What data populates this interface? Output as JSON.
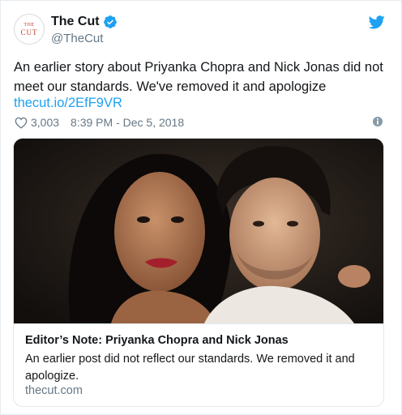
{
  "account": {
    "display_name": "The Cut",
    "handle": "@TheCut",
    "avatar_line1": "THE",
    "avatar_line2": "CUT",
    "verified": true,
    "verified_icon": "verified-badge-icon"
  },
  "tweet": {
    "text": "An earlier story about Priyanka Chopra and Nick Jonas did not meet our standards. We've removed it and apologize",
    "link": "thecut.io/2EfF9VR",
    "likes": "3,003",
    "timestamp": "8:39 PM - Dec 5, 2018"
  },
  "card": {
    "title": "Editor’s Note: Priyanka Chopra and Nick Jonas",
    "description": "An earlier post did not reflect our standards. We removed it and apologize.",
    "domain": "thecut.com"
  },
  "icons": {
    "like": "heart-icon",
    "info": "info-icon",
    "brand": "twitter-bird-icon"
  },
  "colors": {
    "accent": "#1da1f2",
    "text": "#14171a",
    "muted": "#657786",
    "border": "#e1e8ed"
  }
}
